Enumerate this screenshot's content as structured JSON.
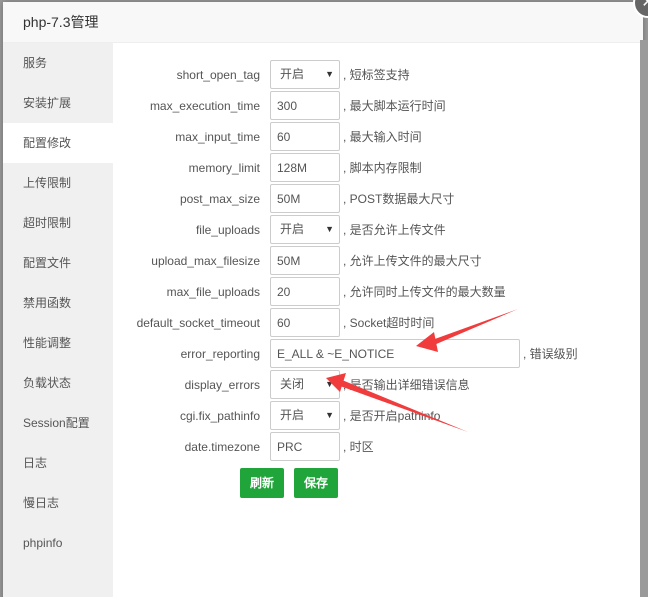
{
  "dialog": {
    "title": "php-7.3管理",
    "close_label": "✕"
  },
  "sidebar": {
    "items": [
      {
        "label": "服务",
        "active": false
      },
      {
        "label": "安装扩展",
        "active": false
      },
      {
        "label": "配置修改",
        "active": true
      },
      {
        "label": "上传限制",
        "active": false
      },
      {
        "label": "超时限制",
        "active": false
      },
      {
        "label": "配置文件",
        "active": false
      },
      {
        "label": "禁用函数",
        "active": false
      },
      {
        "label": "性能调整",
        "active": false
      },
      {
        "label": "负载状态",
        "active": false
      },
      {
        "label": "Session配置",
        "active": false
      },
      {
        "label": "日志",
        "active": false
      },
      {
        "label": "慢日志",
        "active": false
      },
      {
        "label": "phpinfo",
        "active": false
      }
    ]
  },
  "config": {
    "rows": [
      {
        "key": "short_open_tag",
        "type": "select",
        "value": "开启",
        "desc": ", 短标签支持"
      },
      {
        "key": "max_execution_time",
        "type": "input",
        "value": "300",
        "desc": ", 最大脚本运行时间"
      },
      {
        "key": "max_input_time",
        "type": "input",
        "value": "60",
        "desc": ", 最大输入时间"
      },
      {
        "key": "memory_limit",
        "type": "input",
        "value": "128M",
        "desc": ", 脚本内存限制"
      },
      {
        "key": "post_max_size",
        "type": "input",
        "value": "50M",
        "desc": ", POST数据最大尺寸"
      },
      {
        "key": "file_uploads",
        "type": "select",
        "value": "开启",
        "desc": ", 是否允许上传文件"
      },
      {
        "key": "upload_max_filesize",
        "type": "input",
        "value": "50M",
        "desc": ", 允许上传文件的最大尺寸"
      },
      {
        "key": "max_file_uploads",
        "type": "input",
        "value": "20",
        "desc": ", 允许同时上传文件的最大数量"
      },
      {
        "key": "default_socket_timeout",
        "type": "input",
        "value": "60",
        "desc": ", Socket超时时间"
      },
      {
        "key": "error_reporting",
        "type": "input-wide",
        "value": "E_ALL & ~E_NOTICE",
        "desc": ", 错误级别"
      },
      {
        "key": "display_errors",
        "type": "select",
        "value": "关闭",
        "desc": ", 是否输出详细错误信息"
      },
      {
        "key": "cgi.fix_pathinfo",
        "type": "select",
        "value": "开启",
        "desc": ", 是否开启pathinfo"
      },
      {
        "key": "date.timezone",
        "type": "input",
        "value": "PRC",
        "desc": ", 时区"
      }
    ],
    "caret": "▼"
  },
  "buttons": {
    "refresh": "刷新",
    "save": "保存"
  },
  "colors": {
    "accent": "#20a53a",
    "annotation_arrow": "#f03c3c"
  }
}
